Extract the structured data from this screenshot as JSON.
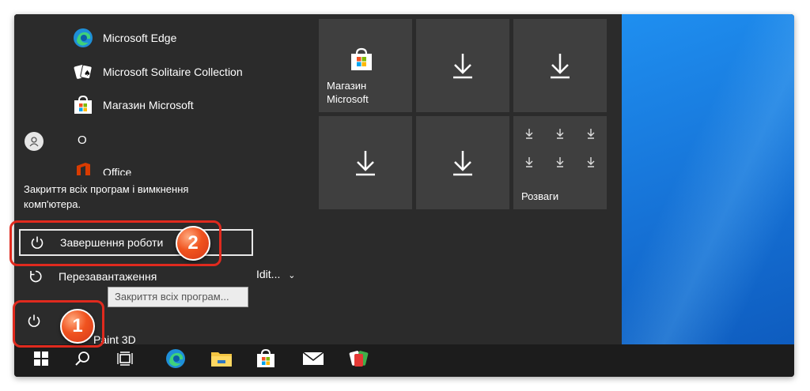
{
  "apps": [
    {
      "label": "Microsoft Edge",
      "icon": "edge-icon"
    },
    {
      "label": "Microsoft Solitaire Collection",
      "icon": "solitaire-icon"
    },
    {
      "label": "Магазин Microsoft",
      "icon": "store-icon"
    }
  ],
  "letter_header": "O",
  "office_label": "Office",
  "paint_label": "Paint 3D",
  "partial_text": "Idit...",
  "tooltip_text": "Закриття всіх програм і вимкнення комп'ютера.",
  "power_menu": {
    "shutdown_label": "Завершення роботи",
    "restart_label": "Перезавантаження"
  },
  "hover_tooltip": "Закриття всіх програм...",
  "tiles": [
    {
      "label": "Магазин Microsoft",
      "icon": "store-icon"
    },
    {
      "label": "",
      "icon": "download-icon"
    },
    {
      "label": "",
      "icon": "download-icon"
    },
    {
      "label": "",
      "icon": "download-icon"
    },
    {
      "label": "",
      "icon": "download-icon"
    },
    {
      "label": "Розваги",
      "icon": "download-group-icon"
    }
  ],
  "callouts": {
    "one": "1",
    "two": "2"
  },
  "taskbar": [
    "start-icon",
    "search-icon",
    "task-view-icon",
    "edge-icon",
    "file-explorer-icon",
    "store-icon",
    "mail-icon",
    "solitaire-icon"
  ],
  "colors": {
    "accent": "#0078d7",
    "callout": "#e02a1e",
    "menu_bg": "#2b2b2b",
    "tile_bg": "#3f3f3f"
  }
}
